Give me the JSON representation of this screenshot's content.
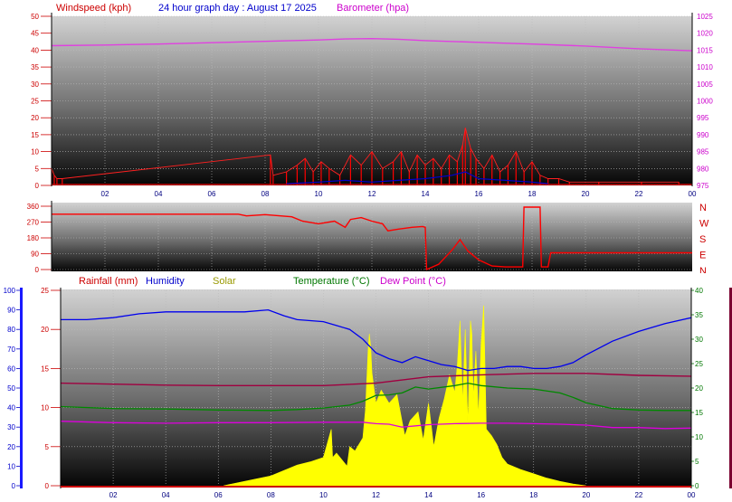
{
  "top": {
    "title": "24 hour graph day : August 17 2025",
    "left_label": "Windspeed (kph)",
    "right_label": "Barometer (hpa)"
  },
  "bottom": {
    "legend": [
      {
        "label": "Rainfall (mm)",
        "color": "#cc0000"
      },
      {
        "label": "Humidity",
        "color": "#0000cc"
      },
      {
        "label": "Solar",
        "color": "#999900"
      },
      {
        "label": "Temperature (°C)",
        "color": "#007700"
      },
      {
        "label": "Dew Point (°C)",
        "color": "#cc00cc"
      }
    ]
  },
  "chart_data": [
    {
      "type": "line",
      "title": "24 hour graph day : August 17 2025",
      "x_ticks": [
        "02",
        "04",
        "06",
        "08",
        "10",
        "12",
        "14",
        "16",
        "18",
        "20",
        "22",
        "00"
      ],
      "y_left": {
        "label": "Windspeed (kph)",
        "ticks": [
          "0",
          "5",
          "10",
          "15",
          "20",
          "25",
          "30",
          "35",
          "40",
          "45",
          "50"
        ],
        "range": [
          0,
          50
        ]
      },
      "y_right": {
        "label": "Barometer (hpa)",
        "ticks": [
          "975",
          "980",
          "985",
          "990",
          "995",
          "1000",
          "1005",
          "1010",
          "1015",
          "1020",
          "1025"
        ],
        "range": [
          975,
          1025
        ]
      },
      "series": [
        {
          "name": "Barometer (hpa)",
          "color": "#e040e0",
          "x": [
            0,
            2,
            4,
            6,
            8,
            10,
            11,
            12,
            13,
            14,
            16,
            18,
            20,
            22,
            24
          ],
          "y": [
            1016.3,
            1016.5,
            1016.8,
            1017.2,
            1017.6,
            1018.0,
            1018.3,
            1018.4,
            1018.2,
            1017.8,
            1017.3,
            1016.8,
            1016.2,
            1015.4,
            1014.8
          ]
        },
        {
          "name": "Wind speed",
          "color": "#ff0000",
          "x": [
            0,
            0.1,
            0.2,
            0.4,
            8.2,
            8.3,
            8.8,
            9.2,
            9.5,
            9.8,
            10.1,
            10.4,
            10.8,
            11.2,
            11.6,
            12.0,
            12.4,
            12.8,
            13.1,
            13.4,
            13.7,
            14.0,
            14.3,
            14.6,
            14.9,
            15.2,
            15.4,
            15.5,
            15.7,
            15.9,
            16.2,
            16.5,
            16.8,
            17.1,
            17.4,
            17.7,
            18.0,
            18.3,
            18.6,
            19.0,
            19.4,
            20.5,
            22.1,
            23.5
          ],
          "y": [
            5,
            3,
            2,
            2,
            9,
            3,
            4,
            6,
            8,
            4,
            7,
            5,
            3,
            9,
            6,
            10,
            5,
            7,
            10,
            4,
            9,
            6,
            8,
            5,
            9,
            7,
            12,
            17,
            11,
            8,
            5,
            9,
            4,
            6,
            10,
            4,
            7,
            3,
            2,
            2,
            1,
            1,
            1,
            1
          ]
        },
        {
          "name": "Wind gust (low)",
          "color": "#0000cc",
          "x": [
            8.8,
            10,
            11,
            12,
            13,
            14,
            15,
            15.5,
            16,
            17,
            18,
            18.6
          ],
          "y": [
            0.5,
            1,
            1.5,
            1,
            1.5,
            2,
            3,
            4,
            2,
            1.5,
            1,
            0.5
          ]
        }
      ]
    },
    {
      "type": "line",
      "title": "",
      "x_ticks": [],
      "y_left": {
        "ticks": [
          "360",
          "270",
          "180",
          "90",
          "0"
        ],
        "range": [
          0,
          360
        ]
      },
      "y_right": {
        "ticks": [
          "N",
          "W",
          "S",
          "E",
          "N"
        ]
      },
      "series": [
        {
          "name": "Wind direction",
          "color": "#ff0000",
          "x": [
            0,
            4,
            7,
            7.3,
            8,
            9,
            9.4,
            10,
            10.6,
            11,
            11.2,
            11.6,
            12,
            12.4,
            12.6,
            13,
            13.5,
            13.9,
            14,
            14.05,
            14.5,
            15,
            15.3,
            15.6,
            16,
            16.5,
            17,
            17.6,
            17.65,
            17.7,
            18.3,
            18.35,
            18.6,
            18.7,
            24
          ],
          "y": [
            315,
            315,
            315,
            305,
            312,
            300,
            275,
            260,
            275,
            240,
            285,
            295,
            275,
            260,
            220,
            230,
            240,
            245,
            240,
            0,
            30,
            110,
            170,
            105,
            55,
            20,
            15,
            15,
            15,
            355,
            355,
            15,
            15,
            95,
            95
          ]
        }
      ]
    },
    {
      "type": "line",
      "title": "",
      "x_ticks": [
        "02",
        "04",
        "06",
        "08",
        "10",
        "12",
        "14",
        "16",
        "18",
        "20",
        "22",
        "00"
      ],
      "y_left": {
        "ticks": [
          "0",
          "10",
          "20",
          "30",
          "40",
          "50",
          "60",
          "70",
          "80",
          "90",
          "100"
        ],
        "range": [
          0,
          100
        ]
      },
      "y_left2": {
        "ticks": [
          "0",
          "5",
          "10",
          "15",
          "20",
          "25"
        ],
        "range": [
          0,
          25
        ]
      },
      "y_right": {
        "ticks": [
          "0",
          "5",
          "10",
          "15",
          "20",
          "25",
          "30",
          "35",
          "40"
        ],
        "range": [
          0,
          40
        ]
      },
      "series": [
        {
          "name": "Humidity",
          "color": "#0000ee",
          "x": [
            0,
            1,
            2,
            3,
            4,
            5,
            6,
            7,
            7.9,
            8.5,
            9,
            10,
            10.5,
            11,
            11.5,
            12,
            12.5,
            13,
            13.5,
            14,
            14.5,
            15,
            15.5,
            16,
            16.5,
            17,
            17.5,
            18,
            18.5,
            19,
            19.5,
            20,
            21,
            22,
            23,
            24
          ],
          "y": [
            85,
            85,
            86,
            88,
            89,
            89,
            89,
            89,
            90,
            87,
            85,
            84,
            82,
            80,
            75,
            68,
            65,
            63,
            66,
            64,
            62,
            61,
            59,
            60,
            60,
            61,
            61,
            60,
            60,
            61,
            63,
            67,
            74,
            79,
            83,
            86
          ]
        },
        {
          "name": "Temperature (°C)",
          "color": "#008800",
          "x": [
            0,
            2,
            4,
            6,
            8,
            9,
            10,
            11,
            11.5,
            12,
            12.5,
            13,
            13.5,
            14,
            15,
            15.5,
            16,
            17,
            18,
            19,
            19.5,
            20,
            21,
            22,
            23,
            24
          ],
          "y": [
            16.2,
            15.8,
            15.7,
            15.5,
            15.4,
            15.6,
            15.9,
            16.5,
            17.3,
            18.5,
            18.6,
            19.0,
            20.2,
            19.8,
            20.5,
            21.0,
            20.5,
            20.0,
            19.8,
            19.0,
            18.1,
            17.0,
            15.8,
            15.5,
            15.4,
            15.4
          ]
        },
        {
          "name": "Dew Point (°C)",
          "color": "#dd00dd",
          "x": [
            0,
            2,
            4,
            6,
            8,
            10,
            11,
            11.5,
            12,
            12.5,
            13,
            14,
            15,
            16,
            17,
            18,
            19,
            20,
            21,
            22,
            23,
            24
          ],
          "y": [
            13.2,
            12.9,
            12.8,
            12.9,
            12.9,
            13.0,
            13.0,
            13.0,
            12.7,
            12.6,
            12.0,
            12.5,
            12.7,
            12.8,
            12.8,
            12.7,
            12.6,
            12.4,
            11.9,
            11.9,
            11.7,
            11.8
          ]
        },
        {
          "name": "Max temperature line",
          "color": "#a00040",
          "x": [
            0,
            2,
            4,
            6,
            8,
            10,
            12,
            14,
            16,
            18,
            20,
            22,
            24
          ],
          "y": [
            21.0,
            20.8,
            20.6,
            20.5,
            20.5,
            20.5,
            21.0,
            22.3,
            22.7,
            23.0,
            23.0,
            22.6,
            22.4
          ]
        },
        {
          "name": "Solar",
          "color": "#ffff00",
          "x": [
            6.2,
            7,
            8,
            8.5,
            9,
            9.5,
            10,
            10.3,
            10.35,
            10.5,
            10.9,
            11,
            11.2,
            11.5,
            11.6,
            11.7,
            11.75,
            11.8,
            11.85,
            12,
            12.2,
            12.5,
            12.8,
            13.1,
            13.3,
            13.6,
            13.8,
            14,
            14.2,
            14.4,
            14.6,
            14.8,
            15,
            15.1,
            15.2,
            15.3,
            15.4,
            15.5,
            15.6,
            15.65,
            15.7,
            15.8,
            15.9,
            16,
            16.1,
            16.2,
            16.4,
            16.6,
            16.8,
            17,
            17.5,
            18,
            18.5,
            19,
            19.5,
            20
          ],
          "y": [
            0,
            20,
            45,
            70,
            95,
            110,
            130,
            260,
            130,
            150,
            90,
            180,
            160,
            220,
            350,
            620,
            700,
            640,
            520,
            380,
            440,
            380,
            420,
            230,
            300,
            340,
            210,
            380,
            180,
            310,
            400,
            510,
            430,
            560,
            760,
            380,
            720,
            280,
            760,
            700,
            400,
            620,
            320,
            650,
            830,
            260,
            230,
            190,
            130,
            100,
            75,
            55,
            35,
            20,
            8,
            0
          ]
        },
        {
          "name": "Rainfall (mm)",
          "color": "#cc0000",
          "x": [
            0,
            24
          ],
          "y": [
            0,
            0
          ]
        }
      ]
    }
  ]
}
